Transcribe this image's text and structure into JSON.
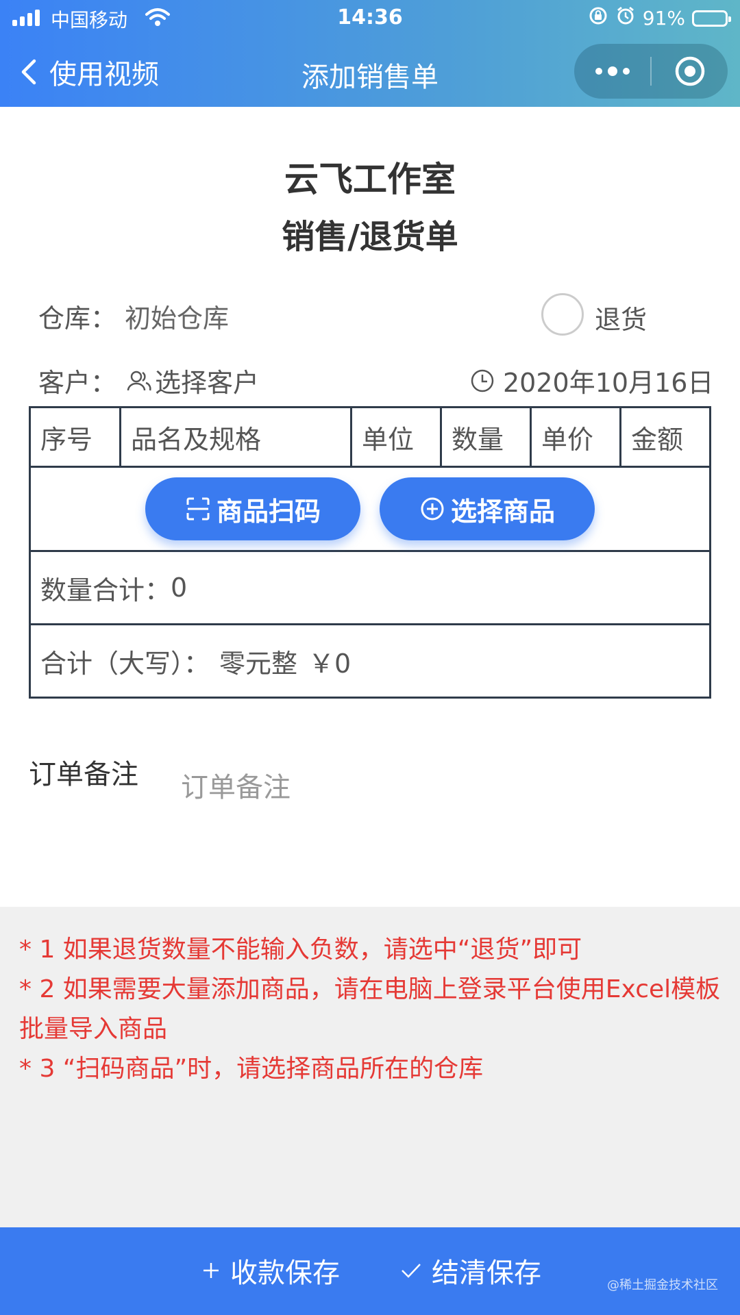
{
  "status_bar": {
    "carrier": "中国移动",
    "time": "14:36",
    "battery": "91%",
    "battery_level": 0.91
  },
  "nav": {
    "back_label": "使用视频",
    "title": "添加销售单"
  },
  "header": {
    "company": "云飞工作室",
    "title": "销售/退货单"
  },
  "form": {
    "warehouse_label": "仓库：",
    "warehouse_value": "初始仓库",
    "return_label": "退货",
    "customer_label": "客户：",
    "customer_placeholder": "选择客户",
    "date": "2020年10月16日"
  },
  "table": {
    "columns": [
      "序号",
      "品名及规格",
      "单位",
      "数量",
      "单价",
      "金额"
    ],
    "scan_button": "商品扫码",
    "select_button": "选择商品",
    "quantity_total_label": "数量合计：",
    "quantity_total_value": "0",
    "total_label": "合计（大写）：",
    "total_upper": "零元整",
    "total_amount": "￥0"
  },
  "remark": {
    "label": "订单备注",
    "placeholder": "订单备注"
  },
  "notes": [
    "* 1 如果退货数量不能输入负数，请选中“退货”即可",
    "* 2 如果需要大量添加商品，请在电脑上登录平台使用Excel模板批量导入商品",
    "* 3 “扫码商品”时，请选择商品所在的仓库"
  ],
  "bottom_bar": {
    "save_with_payment": "收款保存",
    "settle_save": "结清保存",
    "watermark": "@稀土掘金技术社区"
  },
  "colors": {
    "primary": "#3a7bf0",
    "note_red": "#e53935",
    "notes_bg": "#f0f0f0"
  }
}
